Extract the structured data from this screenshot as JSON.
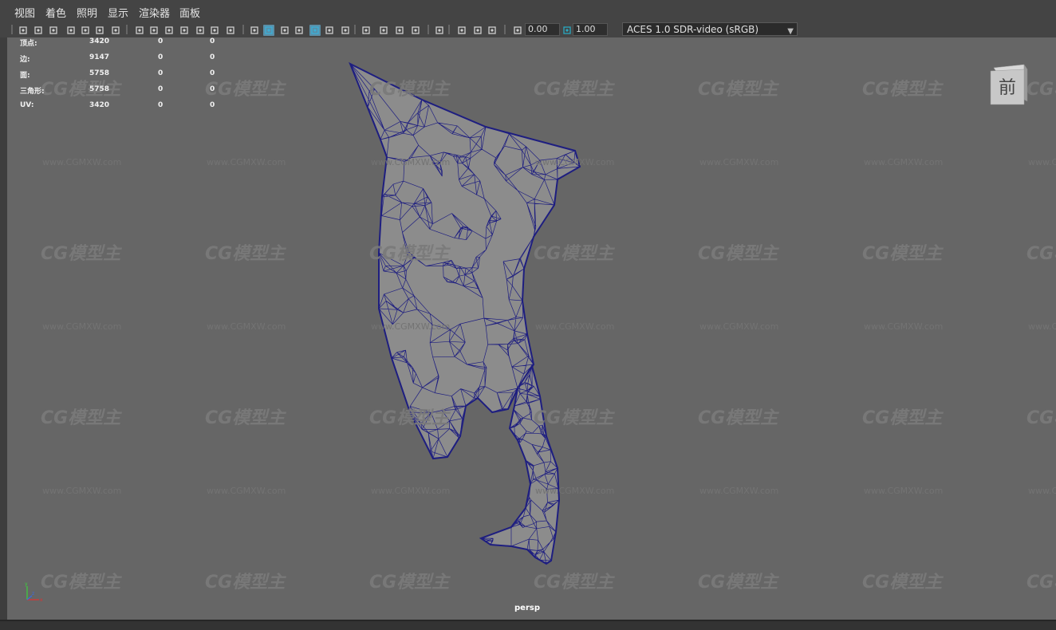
{
  "menu": [
    "视图",
    "着色",
    "照明",
    "显示",
    "渲染器",
    "面板"
  ],
  "toolbar": {
    "exposure_value": "0.00",
    "gamma_value": "1.00",
    "color_space": "ACES 1.0 SDR-video (sRGB)",
    "icons": [
      "camera-icon",
      "camera-attributes-icon",
      "bookmark-icon",
      "image-plane-icon",
      "2d-pan-icon",
      "grease-pencil-icon",
      "grid-icon",
      "film-gate-icon",
      "resolution-gate-icon",
      "gate-mask-icon",
      "field-chart-icon",
      "safe-action-icon",
      "safe-title-icon",
      "wireframe-icon",
      "smooth-shade-icon",
      "default-material-icon",
      "shaded-wireframe-icon",
      "textured-icon",
      "lighting-icon",
      "shadows-icon",
      "isolate-select-icon",
      "xray-icon",
      "xray-joints-icon",
      "backface-culling-icon",
      "screen-space-ao-icon",
      "motion-blur-icon",
      "multisample-aa-icon",
      "depth-of-field-icon",
      "exposure-icon",
      "gamma-icon",
      "color-management-icon"
    ]
  },
  "hud": {
    "rows": [
      {
        "label": "顶点:",
        "v1": "3420",
        "v2": "0",
        "v3": "0"
      },
      {
        "label": "边:",
        "v1": "9147",
        "v2": "0",
        "v3": "0"
      },
      {
        "label": "面:",
        "v1": "5758",
        "v2": "0",
        "v3": "0"
      },
      {
        "label": "三角形:",
        "v1": "5758",
        "v2": "0",
        "v3": "0"
      },
      {
        "label": "UV:",
        "v1": "3420",
        "v2": "0",
        "v3": "0"
      }
    ]
  },
  "viewcube_label": "前",
  "camera_name": "persp",
  "watermark": {
    "logo": "CG模型主",
    "url": "www.CGMXW.com"
  },
  "colors": {
    "viewport_bg": "#666666",
    "wire": "#1e1e80",
    "mesh_fill": "#8c8c8c"
  }
}
